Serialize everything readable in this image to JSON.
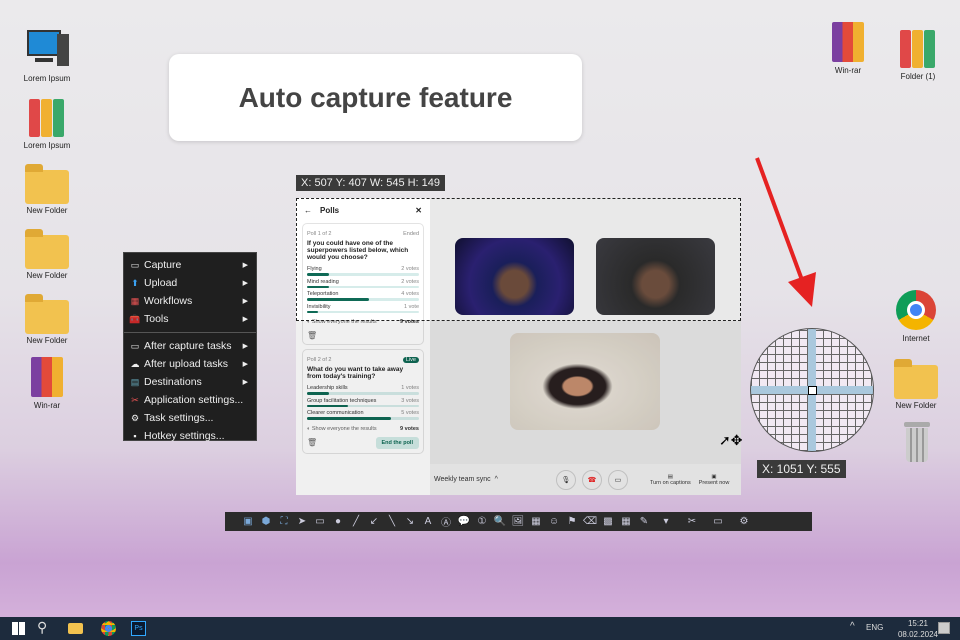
{
  "title": "Auto capture feature",
  "desktop_left": [
    {
      "label": "Lorem Ipsum",
      "icon": "computer-icon"
    },
    {
      "label": "Lorem Ipsum",
      "icon": "binders-icon"
    },
    {
      "label": "New Folder",
      "icon": "folder-icon"
    },
    {
      "label": "New Folder",
      "icon": "folder-icon"
    },
    {
      "label": "New Folder",
      "icon": "folder-icon"
    },
    {
      "label": "Win-rar",
      "icon": "winrar-icon"
    }
  ],
  "desktop_right": [
    {
      "label": "Win-rar",
      "icon": "winrar-icon"
    },
    {
      "label": "Folder (1)",
      "icon": "binders-icon"
    },
    {
      "label": "Internet",
      "icon": "chrome-icon"
    },
    {
      "label": "New Folder",
      "icon": "folder-icon"
    },
    {
      "label": "",
      "icon": "recycle-bin-icon"
    }
  ],
  "menu": {
    "items": [
      {
        "label": "Capture",
        "icon": "▭",
        "sub": true
      },
      {
        "label": "Upload",
        "icon": "⬆",
        "sub": true
      },
      {
        "label": "Workflows",
        "icon": "▦",
        "sub": true
      },
      {
        "label": "Tools",
        "icon": "🧰",
        "sub": true
      }
    ],
    "items2": [
      {
        "label": "After capture tasks",
        "icon": "▭",
        "sub": true
      },
      {
        "label": "After upload tasks",
        "icon": "☁",
        "sub": true
      },
      {
        "label": "Destinations",
        "icon": "▤",
        "sub": true
      },
      {
        "label": "Application settings...",
        "icon": "✂",
        "sub": false
      },
      {
        "label": "Task settings...",
        "icon": "⚙",
        "sub": false
      },
      {
        "label": "Hotkey settings...",
        "icon": "▪",
        "sub": false
      }
    ]
  },
  "region_label": "X: 507 Y: 407 W: 545 H: 149",
  "cursor_label": "X: 1051 Y: 555",
  "polls": {
    "title": "Polls",
    "poll1": {
      "meta": "Poll 1 of 2",
      "status": "Ended",
      "question": "If you could have one of the superpowers listed below, which would you choose?",
      "options": [
        {
          "label": "Flying",
          "votes": "2 votes",
          "pct": 20
        },
        {
          "label": "Mind reading",
          "votes": "2 votes",
          "pct": 20
        },
        {
          "label": "Teleportation",
          "votes": "4 votes",
          "pct": 55
        },
        {
          "label": "Invisibility",
          "votes": "1 vote",
          "pct": 10
        }
      ],
      "toggle": "Show everyone the results",
      "total": "9 votes"
    },
    "poll2": {
      "meta": "Poll 2 of 2",
      "status": "Live",
      "question": "What do you want to take away from today's training?",
      "options": [
        {
          "label": "Leadership skills",
          "votes": "1 votes",
          "pct": 20
        },
        {
          "label": "Group facilitation techniques",
          "votes": "3 votes",
          "pct": 37
        },
        {
          "label": "Clearer communication",
          "votes": "5 votes",
          "pct": 75
        }
      ],
      "toggle": "Show everyone the results",
      "total": "9 votes",
      "end": "End the poll"
    }
  },
  "meeting": {
    "name": "Weekly team sync",
    "captions": "Turn on captions",
    "present": "Present now"
  },
  "toolbar": [
    "region",
    "ellipse-region",
    "freehand-region",
    "cursor",
    "rectangle",
    "ellipse",
    "line",
    "arrow",
    "pen",
    "pen-arrow",
    "text-outline",
    "text-box",
    "speech-balloon",
    "step",
    "magnify",
    "image",
    "sticker",
    "emoji",
    "stamp",
    "eraser",
    "blur",
    "pixelate",
    "highlight",
    "options",
    "tools",
    "capture",
    "settings"
  ],
  "taskbar": {
    "lang": "ENG",
    "time": "15:21",
    "date": "08.02.2024"
  },
  "colors": {
    "accent": "#0f6a56",
    "arrow": "#e52222"
  }
}
